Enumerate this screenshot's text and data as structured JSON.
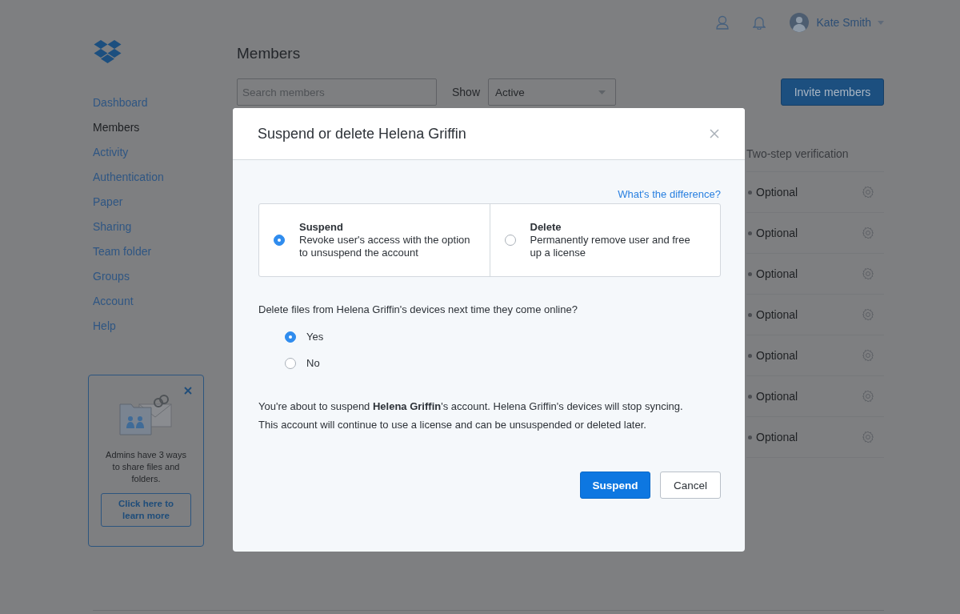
{
  "topbar": {
    "user_name": "Kate Smith"
  },
  "sidebar": {
    "items": [
      {
        "label": "Dashboard",
        "selected": false
      },
      {
        "label": "Members",
        "selected": true
      },
      {
        "label": "Activity",
        "selected": false
      },
      {
        "label": "Authentication",
        "selected": false
      },
      {
        "label": "Paper",
        "selected": false
      },
      {
        "label": "Sharing",
        "selected": false
      },
      {
        "label": "Team folder",
        "selected": false
      },
      {
        "label": "Groups",
        "selected": false
      },
      {
        "label": "Account",
        "selected": false
      },
      {
        "label": "Help",
        "selected": false
      }
    ]
  },
  "promo": {
    "text": "Admins have 3 ways to share files and folders.",
    "button": "Click here to learn more"
  },
  "page_title": "Members",
  "search": {
    "placeholder": "Search members"
  },
  "filter": {
    "label": "Show",
    "value": "Active"
  },
  "invite_button": "Invite members",
  "table": {
    "column": "Two-step verification",
    "rows": [
      {
        "value": "Optional"
      },
      {
        "value": "Optional"
      },
      {
        "value": "Optional"
      },
      {
        "value": "Optional"
      },
      {
        "value": "Optional"
      },
      {
        "value": "Optional"
      },
      {
        "value": "Optional"
      }
    ]
  },
  "dialog": {
    "title": "Suspend or delete Helena Griffin",
    "help_link": "What's the difference?",
    "options": [
      {
        "title": "Suspend",
        "description": "Revoke user's access with the option to unsuspend the account",
        "selected": true
      },
      {
        "title": "Delete",
        "description": "Permanently remove user and free up a license",
        "selected": false
      }
    ],
    "question": "Delete files from Helena Griffin's devices next time they come online?",
    "answers": [
      {
        "label": "Yes",
        "selected": true
      },
      {
        "label": "No",
        "selected": false
      }
    ],
    "message": [
      "You're about to suspend **Helena Griffin**'s account. Helena Griffin's devices will stop syncing.",
      "This account will continue to use a license and can be unsuspended or deleted later."
    ],
    "buttons": [
      {
        "label": "Suspend",
        "kind": "primary"
      },
      {
        "label": "Cancel",
        "kind": "secondary"
      }
    ]
  }
}
